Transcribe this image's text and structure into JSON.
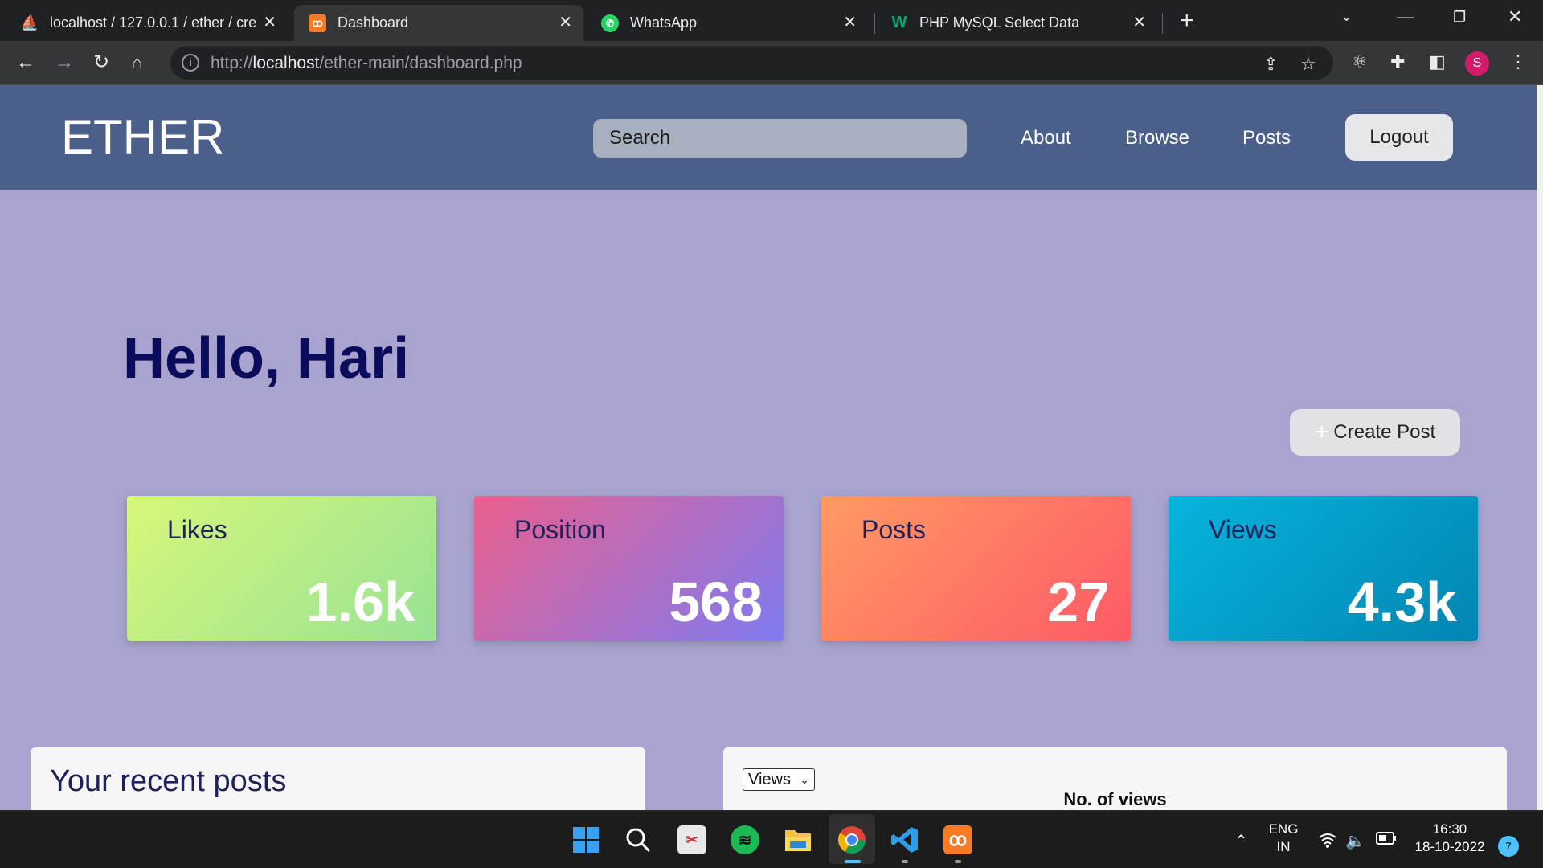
{
  "browser": {
    "tabs": [
      {
        "title": "localhost / 127.0.0.1 / ether / cre",
        "favicon": "phpmyadmin-icon"
      },
      {
        "title": "Dashboard",
        "favicon": "xampp-icon"
      },
      {
        "title": "WhatsApp",
        "favicon": "whatsapp-icon"
      },
      {
        "title": "PHP MySQL Select Data",
        "favicon": "w3schools-icon"
      }
    ],
    "url_scheme": "http://",
    "url_host": "localhost",
    "url_path": "/ether-main/dashboard.php",
    "profile_initial": "S"
  },
  "site": {
    "logo": "ETHER",
    "search_placeholder": "Search",
    "nav": {
      "about": "About",
      "browse": "Browse",
      "posts": "Posts"
    },
    "logout": "Logout"
  },
  "main": {
    "greeting": "Hello, Hari",
    "create_post": "Create Post",
    "stats": [
      {
        "label": "Likes",
        "value": "1.6k"
      },
      {
        "label": "Position",
        "value": "568"
      },
      {
        "label": "Posts",
        "value": "27"
      },
      {
        "label": "Views",
        "value": "4.3k"
      }
    ],
    "recent_posts_title": "Your recent posts",
    "views_select": "Views",
    "chart_title": "No. of views"
  },
  "taskbar": {
    "lang_line1": "ENG",
    "lang_line2": "IN",
    "time": "16:30",
    "date": "18-10-2022",
    "notifications": "7"
  },
  "colors": {
    "nav_bg": "#4a5f8a",
    "page_bg": "#a8a4cf",
    "greeting": "#0b0b5c"
  }
}
